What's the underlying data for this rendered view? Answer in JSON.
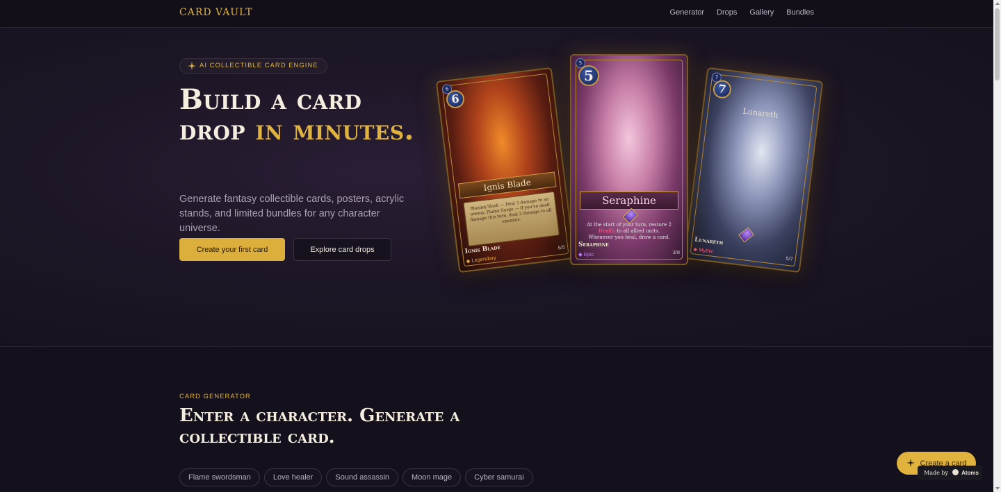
{
  "brand": "CARD VAULT",
  "nav": {
    "items": [
      "Generator",
      "Drops",
      "Gallery",
      "Bundles"
    ]
  },
  "hero": {
    "badge": "AI COLLECTIBLE CARD ENGINE",
    "headline_1": "Build a card",
    "headline_2": "drop ",
    "headline_gold": "in minutes.",
    "lede": "Generate fantasy collectible cards, posters, acrylic stands, and limited bundles for any character universe.",
    "primary_cta": "Create your first card",
    "secondary_cta": "Explore card drops"
  },
  "cards": [
    {
      "name": "Ignis Blade",
      "banner": "Ignis Blade",
      "cost": "6",
      "cost_small": "6",
      "rarity": "Legendary",
      "rarity_color": "#e8a23a",
      "stat": "6/5",
      "text": "Blazing Slash — Deal 3 damage to an enemy. Flame Surge — If you've dealt damage this turn, deal 2 damage to all enemies."
    },
    {
      "name": "Seraphine",
      "banner": "Seraphine",
      "cost": "5",
      "cost_small": "5",
      "rarity": "Epic",
      "rarity_color": "#c079ff",
      "stat": "3/8",
      "text_a": "At the start of your turn, restore 2 ",
      "text_hl": "Health",
      "text_b": " to all allied units. Whenever you heal, draw a card."
    },
    {
      "name": "Lunareth",
      "banner": "Lunareth",
      "cost": "7",
      "cost_small": "7",
      "rarity": "Mythic",
      "rarity_color": "#ff5c7a",
      "stat": "5/7"
    }
  ],
  "generator": {
    "label": "CARD GENERATOR",
    "title": "Enter a character. Generate a collectible card.",
    "chips": [
      "Flame swordsman",
      "Love healer",
      "Sound assassin",
      "Moon mage",
      "Cyber samurai"
    ]
  },
  "fab": {
    "label": "Create a card"
  },
  "madeby": {
    "prefix": "Made by",
    "name": "Atoms"
  }
}
